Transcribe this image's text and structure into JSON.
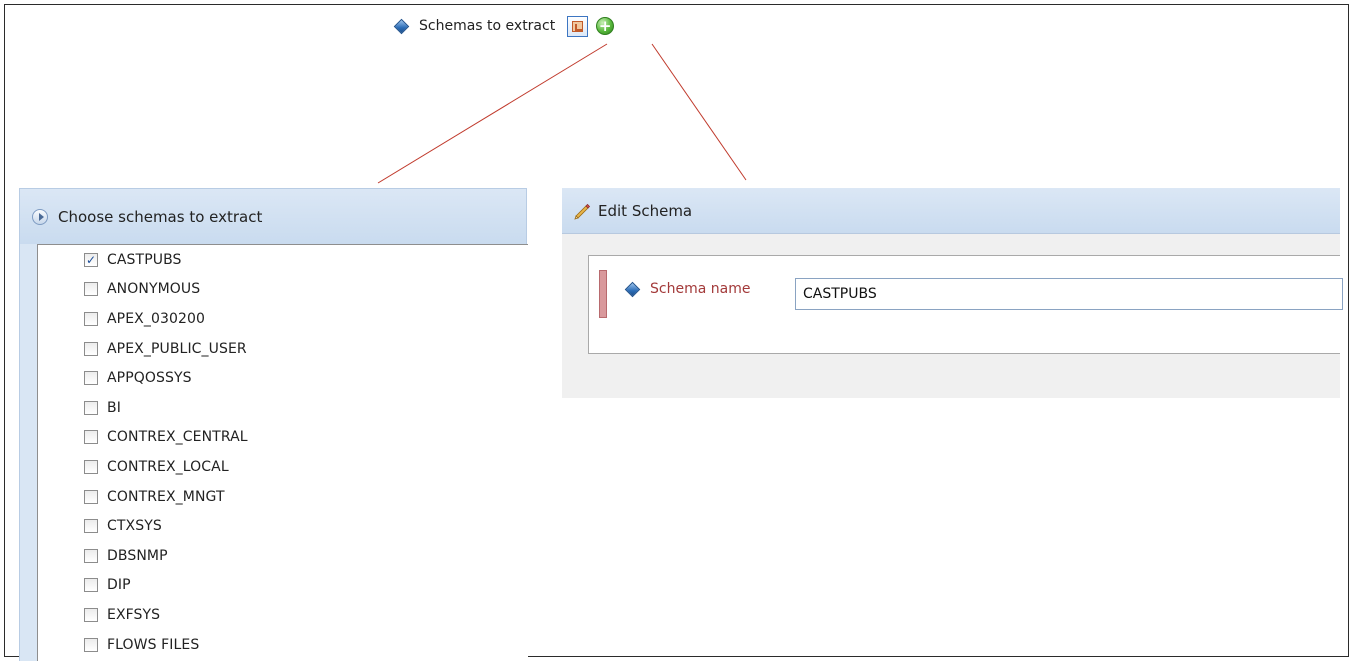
{
  "top": {
    "label": "Schemas to extract",
    "choose_icon": "choose-schemas-icon",
    "add_icon": "add-icon"
  },
  "choose_panel": {
    "title": "Choose schemas to extract",
    "items": [
      {
        "label": "CASTPUBS",
        "checked": true
      },
      {
        "label": "ANONYMOUS",
        "checked": false
      },
      {
        "label": "APEX_030200",
        "checked": false
      },
      {
        "label": "APEX_PUBLIC_USER",
        "checked": false
      },
      {
        "label": "APPQOSSYS",
        "checked": false
      },
      {
        "label": "BI",
        "checked": false
      },
      {
        "label": "CONTREX_CENTRAL",
        "checked": false
      },
      {
        "label": "CONTREX_LOCAL",
        "checked": false
      },
      {
        "label": "CONTREX_MNGT",
        "checked": false
      },
      {
        "label": "CTXSYS",
        "checked": false
      },
      {
        "label": "DBSNMP",
        "checked": false
      },
      {
        "label": "DIP",
        "checked": false
      },
      {
        "label": "EXFSYS",
        "checked": false
      },
      {
        "label": "FLOWS FILES",
        "checked": false
      }
    ]
  },
  "edit_panel": {
    "title": "Edit Schema",
    "field_label": "Schema name",
    "field_value": "CASTPUBS"
  },
  "colors": {
    "connector": "#c0392b",
    "required_label": "#a33a3a",
    "header_bg": "#c9dbef"
  }
}
